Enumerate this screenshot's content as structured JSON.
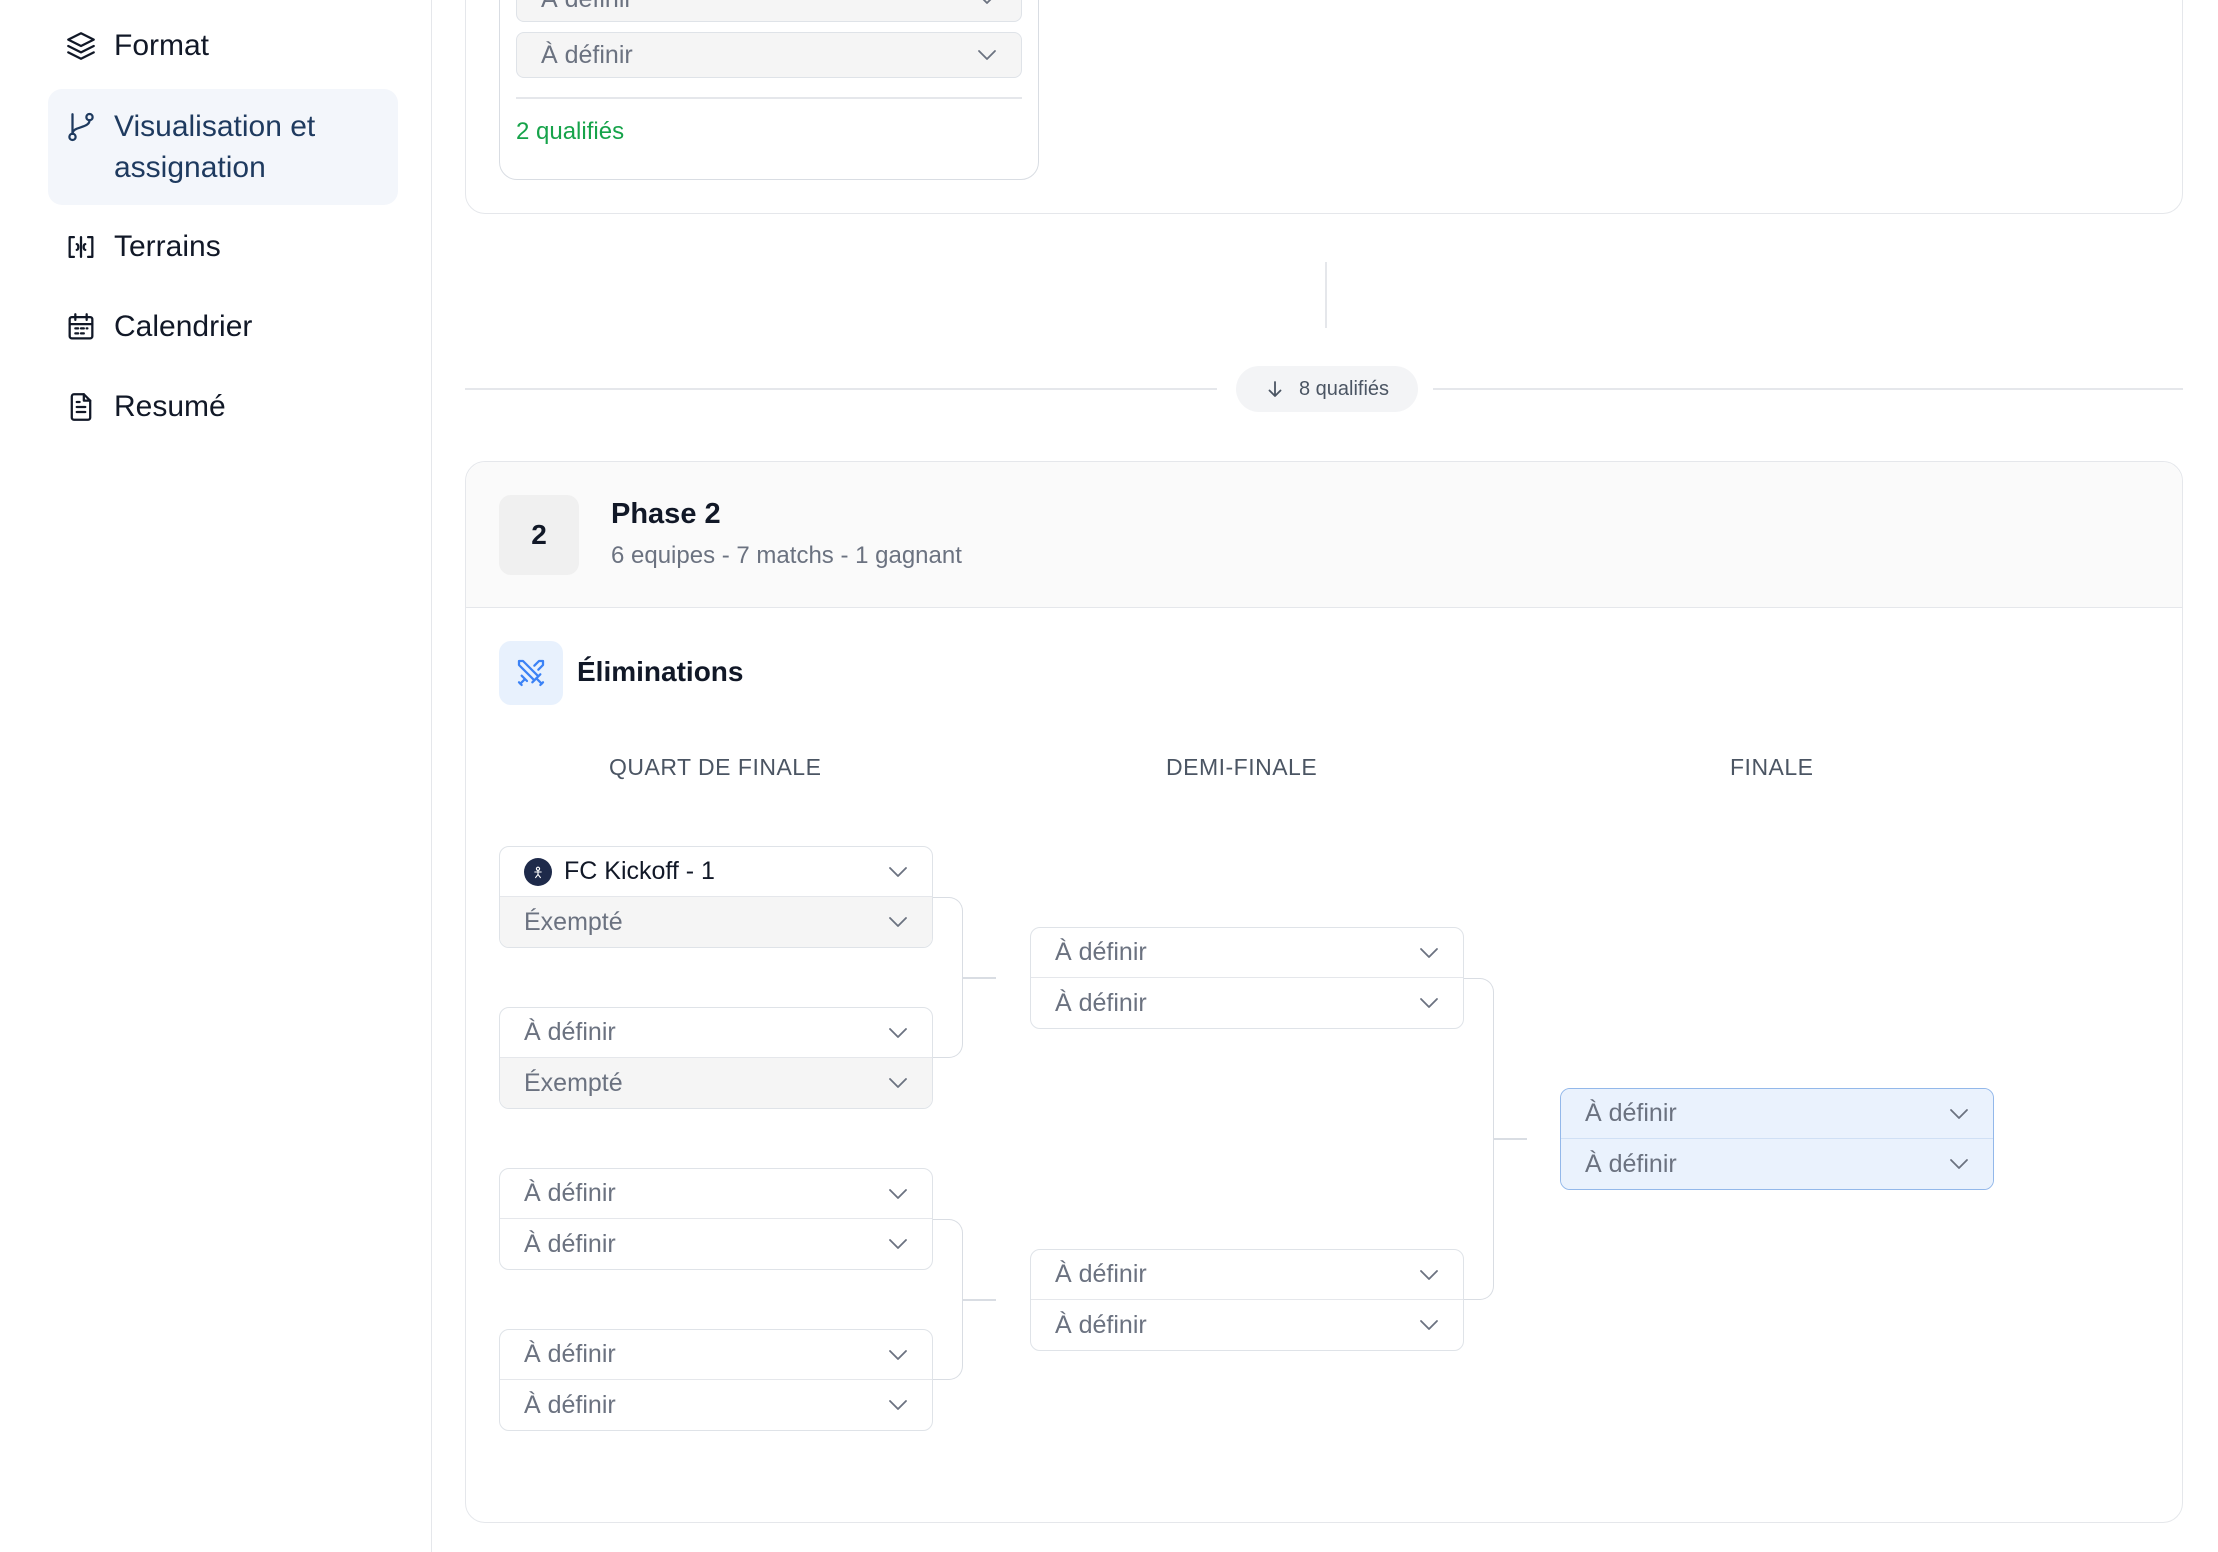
{
  "sidebar": {
    "items": [
      {
        "label": "Format",
        "icon": "layers-icon",
        "active": false
      },
      {
        "label": "Visualisation et assignation",
        "icon": "git-branch-icon",
        "active": true
      },
      {
        "label": "Terrains",
        "icon": "field-icon",
        "active": false
      },
      {
        "label": "Calendrier",
        "icon": "calendar-icon",
        "active": false
      },
      {
        "label": "Resumé",
        "icon": "document-icon",
        "active": false
      }
    ]
  },
  "phase1": {
    "group_slots": [
      "À définir",
      "À définir"
    ],
    "qualified_text": "2 qualifiés"
  },
  "divider": {
    "qualified_text": "8 qualifiés"
  },
  "phase2": {
    "number": "2",
    "title": "Phase 2",
    "subtitle": "6 equipes - 7 matchs - 1 gagnant",
    "section_title": "Éliminations",
    "rounds": [
      "QUART DE FINALE",
      "DEMI-FINALE",
      "FINALE"
    ],
    "quarter_finals": [
      {
        "top": "FC Kickoff - 1",
        "bottom": "Éxempté"
      },
      {
        "top": "À définir",
        "bottom": "Éxempté"
      },
      {
        "top": "À définir",
        "bottom": "À définir"
      },
      {
        "top": "À définir",
        "bottom": "À définir"
      }
    ],
    "semi_finals": [
      {
        "top": "À définir",
        "bottom": "À définir"
      },
      {
        "top": "À définir",
        "bottom": "À définir"
      }
    ],
    "final": {
      "top": "À définir",
      "bottom": "À définir"
    }
  },
  "colors": {
    "accent_green": "#16a34a",
    "active_nav_bg": "#f3f6fb",
    "final_highlight": "#eaf2fd",
    "final_border": "#93b8ea"
  }
}
